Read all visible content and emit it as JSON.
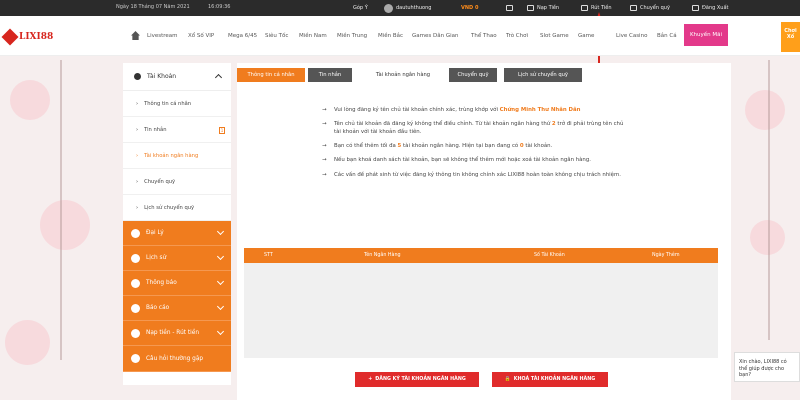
{
  "topbar": {
    "date": "Ngày 18 Tháng 07 Năm 2021",
    "time": "16:09:36",
    "feedback": "Góp Ý",
    "username": "dautuhthuong",
    "balance": "VND 0",
    "deposit": "Nạp Tiền",
    "withdraw": "Rút Tiền",
    "transfer": "Chuyển quỹ",
    "logout": "Đăng Xuất"
  },
  "logo": {
    "text": "LIXI88"
  },
  "nav": {
    "items": [
      "Livestream",
      "Xổ Số VIP",
      "Mega 6/45",
      "Siêu Tốc",
      "Miền Nam",
      "Miền Trung",
      "Miền Bắc",
      "Games Dân Gian",
      "Thể Thao",
      "Trò Chơi",
      "Slot Game",
      "Game",
      "Live Casino",
      "Bắn Cá"
    ],
    "promo": "Khuyến Mãi",
    "chat_corner": "Chơi Xổ"
  },
  "sidebar": {
    "account": "Tài Khoản",
    "sub": [
      "Thông tin cá nhân",
      "Tin nhắn",
      "Tài khoản ngân hàng",
      "Chuyển quỹ",
      "Lịch sử chuyển quỹ"
    ],
    "msg_badge": "1",
    "main": [
      "Đại Lý",
      "Lịch sử",
      "Thông báo",
      "Báo cáo",
      "Nạp tiền - Rút tiền",
      "Câu hỏi thường gặp"
    ]
  },
  "tabs": [
    "Thông tin cá nhân",
    "Tin nhắn",
    "Tài khoản ngân hàng",
    "Chuyển quỹ",
    "Lịch sử chuyển quỹ"
  ],
  "notes": {
    "n1_a": "Vui lòng đăng ký tên chủ tài khoản chính xác, trùng khớp với ",
    "n1_b": "Chứng Minh Thư Nhân Dân",
    "n2_a": "Tên chủ tài khoản đã đăng ký không thể điều chỉnh. Từ tài khoản ngân hàng thứ ",
    "n2_b": "2",
    "n2_c": " trở đi phải trùng tên chủ tài khoản với tài khoản đầu tiên.",
    "n3_a": "Bạn có thể thêm tối đa ",
    "n3_b": "5",
    "n3_c": " tài khoản ngân hàng. Hiện tại bạn đang có ",
    "n3_d": "0",
    "n3_e": " tài khoản.",
    "n4": "Nếu bạn khoá danh sách tài khoản, bạn sẽ không thể thêm mới hoặc xoá tài khoản ngân hàng.",
    "n5": "Các vấn đề phát sinh từ việc đăng ký thông tin không chính xác LIXI88 hoàn toàn không chịu trách nhiệm."
  },
  "table": {
    "headers": [
      "STT",
      "Tên Ngân Hàng",
      "Số Tài Khoản",
      "Ngày Thêm"
    ]
  },
  "buttons": {
    "register": "ĐĂNG KÝ TÀI KHOẢN NGÂN HÀNG",
    "lock": "KHOÁ TÀI KHOẢN NGÂN HÀNG"
  },
  "chat": "Xin chào, LIXI88 có thể giúp được cho bạn?",
  "colors": {
    "accent": "#f07c1e",
    "danger": "#e02b2b",
    "promo": "#e3398a"
  }
}
